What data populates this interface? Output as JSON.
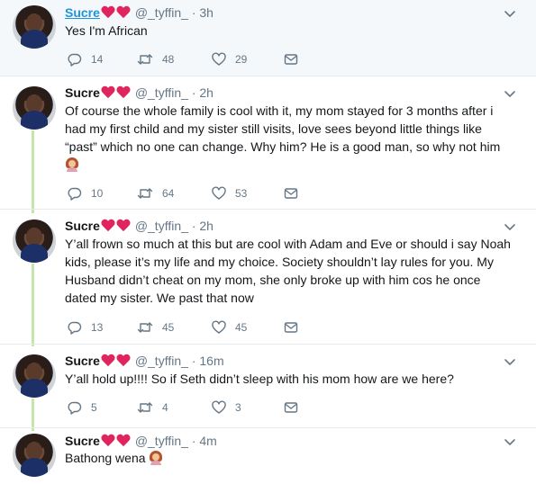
{
  "tweets": [
    {
      "name": "Sucre",
      "handle": "@_tyffin_",
      "dot": "·",
      "time": "3h",
      "lines": [
        "Yes I'm African"
      ],
      "emoji_after_last_line": false,
      "replies": "14",
      "retweets": "48",
      "likes": "29"
    },
    {
      "name": "Sucre",
      "handle": "@_tyffin_",
      "dot": "·",
      "time": "2h",
      "lines": [
        "Of course the whole family is cool with it, my mom stayed for 3 months after i",
        "had my first child and my sister still visits, love sees beyond little things like",
        "“past” which no one can change. Why him? He is a good man, so why not him"
      ],
      "emoji_after_last_line": false,
      "replies": "10",
      "retweets": "64",
      "likes": "53"
    },
    {
      "name": "Sucre",
      "handle": "@_tyffin_",
      "dot": "·",
      "time": "2h",
      "lines": [
        "Y’all frown so much at this but are cool with Adam and Eve or should i say Noah",
        "kids, please it’s my life and my choice. Society shouldn’t lay rules for you. My",
        "Husband didn’t cheat on my mom, she only broke up with him cos he once",
        "dated my sister. We past that now"
      ],
      "emoji_after_last_line": false,
      "replies": "13",
      "retweets": "45",
      "likes": "45"
    },
    {
      "name": "Sucre",
      "handle": "@_tyffin_",
      "dot": "·",
      "time": "16m",
      "lines": [
        "Y’all hold up!!!! So if Seth didn’t sleep with his mom how are we here?"
      ],
      "emoji_after_last_line": false,
      "replies": "5",
      "retweets": "4",
      "likes": "3"
    },
    {
      "name": "Sucre",
      "handle": "@_tyffin_",
      "dot": "·",
      "time": "4m",
      "lines": [
        "Bathong wena"
      ],
      "emoji_after_last_line": true,
      "replies": "",
      "retweets": "",
      "likes": ""
    }
  ],
  "colors": {
    "heart_emoji": "#e0245e",
    "thread_line": "#c4e6a9",
    "link": "#1b95e0",
    "muted": "#657786"
  },
  "icons": [
    "reply-icon",
    "retweet-icon",
    "like-icon",
    "direct-message-icon",
    "chevron-down-icon",
    "red-heart-emoji-icon",
    "person-facepalming-emoji-icon"
  ]
}
